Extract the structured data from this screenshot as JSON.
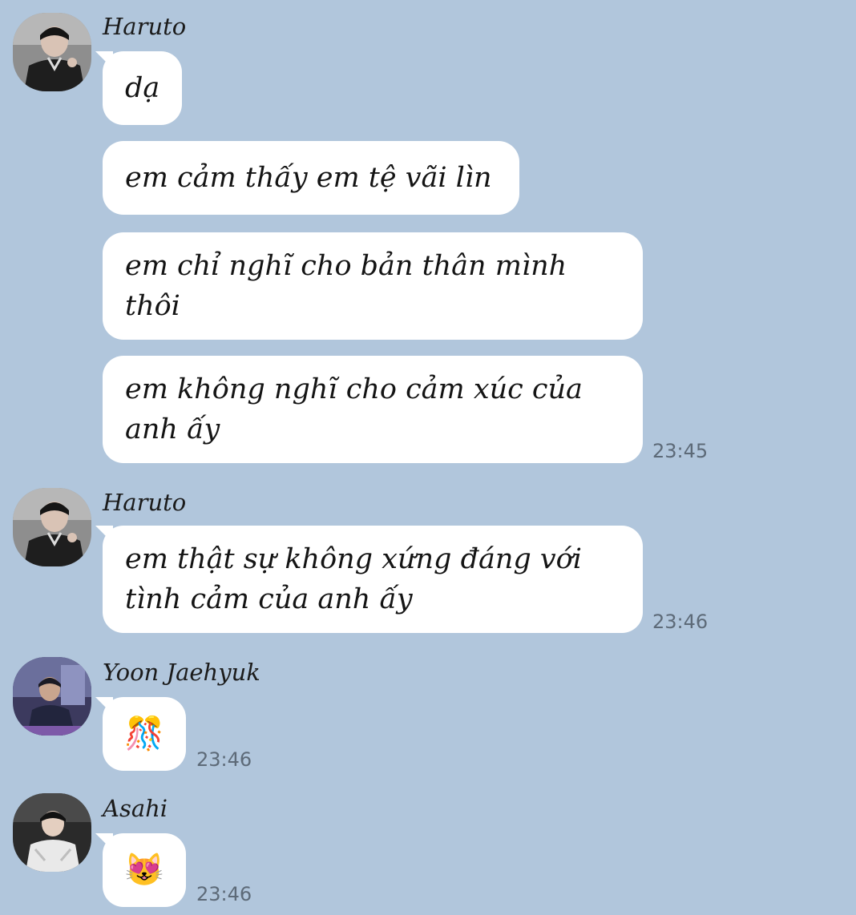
{
  "messages": [
    {
      "sender": "Haruto",
      "avatar": "avatar-haruto",
      "bubbles": [
        "dạ",
        "em cảm thấy em tệ vãi lìn",
        "em chỉ nghĩ cho bản thân mình thôi",
        "em không nghĩ cho cảm xúc của anh ấy"
      ],
      "time": "23:45"
    },
    {
      "sender": "Haruto",
      "avatar": "avatar-haruto",
      "bubbles": [
        "em thật sự không xứng đáng với tình cảm của anh ấy"
      ],
      "time": "23:46"
    },
    {
      "sender": "Yoon Jaehyuk",
      "avatar": "avatar-jaehyuk",
      "bubbles": [
        "🎊"
      ],
      "time": "23:46"
    },
    {
      "sender": "Asahi",
      "avatar": "avatar-asahi",
      "bubbles": [
        "😻"
      ],
      "time": "23:46"
    }
  ],
  "colors": {
    "background": "#b1c6dc",
    "bubble": "#ffffff",
    "timestamp": "#5d6a78"
  }
}
